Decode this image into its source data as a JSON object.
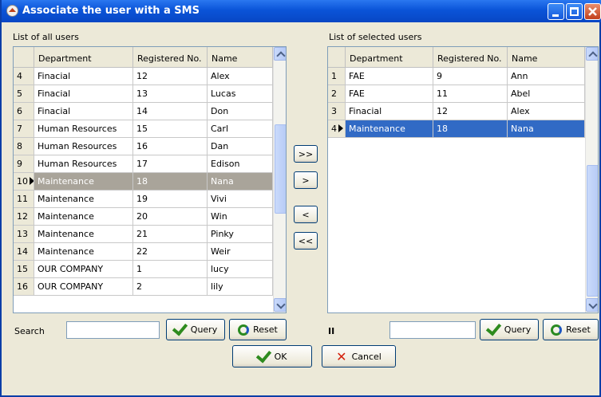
{
  "window": {
    "title": "Associate the user with a SMS"
  },
  "left_panel": {
    "label": "List of all users",
    "columns": [
      "Department",
      "Registered No.",
      "Name"
    ],
    "rows": [
      {
        "num": "4",
        "department": "Finacial",
        "reg_no": "12",
        "name": "Alex"
      },
      {
        "num": "5",
        "department": "Finacial",
        "reg_no": "13",
        "name": "Lucas"
      },
      {
        "num": "6",
        "department": "Finacial",
        "reg_no": "14",
        "name": "Don"
      },
      {
        "num": "7",
        "department": "Human Resources",
        "reg_no": "15",
        "name": "Carl"
      },
      {
        "num": "8",
        "department": "Human Resources",
        "reg_no": "16",
        "name": "Dan"
      },
      {
        "num": "9",
        "department": "Human Resources",
        "reg_no": "17",
        "name": "Edison"
      },
      {
        "num": "10",
        "department": "Maintenance",
        "reg_no": "18",
        "name": "Nana"
      },
      {
        "num": "11",
        "department": "Maintenance",
        "reg_no": "19",
        "name": "Vivi"
      },
      {
        "num": "12",
        "department": "Maintenance",
        "reg_no": "20",
        "name": "Win"
      },
      {
        "num": "13",
        "department": "Maintenance",
        "reg_no": "21",
        "name": "Pinky"
      },
      {
        "num": "14",
        "department": "Maintenance",
        "reg_no": "22",
        "name": "Weir"
      },
      {
        "num": "15",
        "department": "OUR COMPANY",
        "reg_no": "1",
        "name": "lucy"
      },
      {
        "num": "16",
        "department": "OUR COMPANY",
        "reg_no": "2",
        "name": "lily"
      }
    ],
    "selected_row_num": "10",
    "search_label": "Search",
    "search_value": "",
    "query_label": "Query",
    "reset_label": "Reset"
  },
  "right_panel": {
    "label": "List of selected users",
    "columns": [
      "Department",
      "Registered No.",
      "Name"
    ],
    "rows": [
      {
        "num": "1",
        "department": "FAE",
        "reg_no": "9",
        "name": "Ann"
      },
      {
        "num": "2",
        "department": "FAE",
        "reg_no": "11",
        "name": "Abel"
      },
      {
        "num": "3",
        "department": "Finacial",
        "reg_no": "12",
        "name": "Alex"
      },
      {
        "num": "4",
        "department": "Maintenance",
        "reg_no": "18",
        "name": "Nana"
      }
    ],
    "selected_row_num": "4",
    "search_label": "II",
    "search_value": "",
    "query_label": "Query",
    "reset_label": "Reset"
  },
  "transfer_buttons": {
    "add_all": ">>",
    "add": ">",
    "remove": "<",
    "remove_all": "<<"
  },
  "footer": {
    "ok_label": "OK",
    "cancel_label": "Cancel"
  },
  "colors": {
    "title_bar": "#0a54d8",
    "selected_gray": "#a9a49a",
    "selected_blue": "#316ac5"
  }
}
